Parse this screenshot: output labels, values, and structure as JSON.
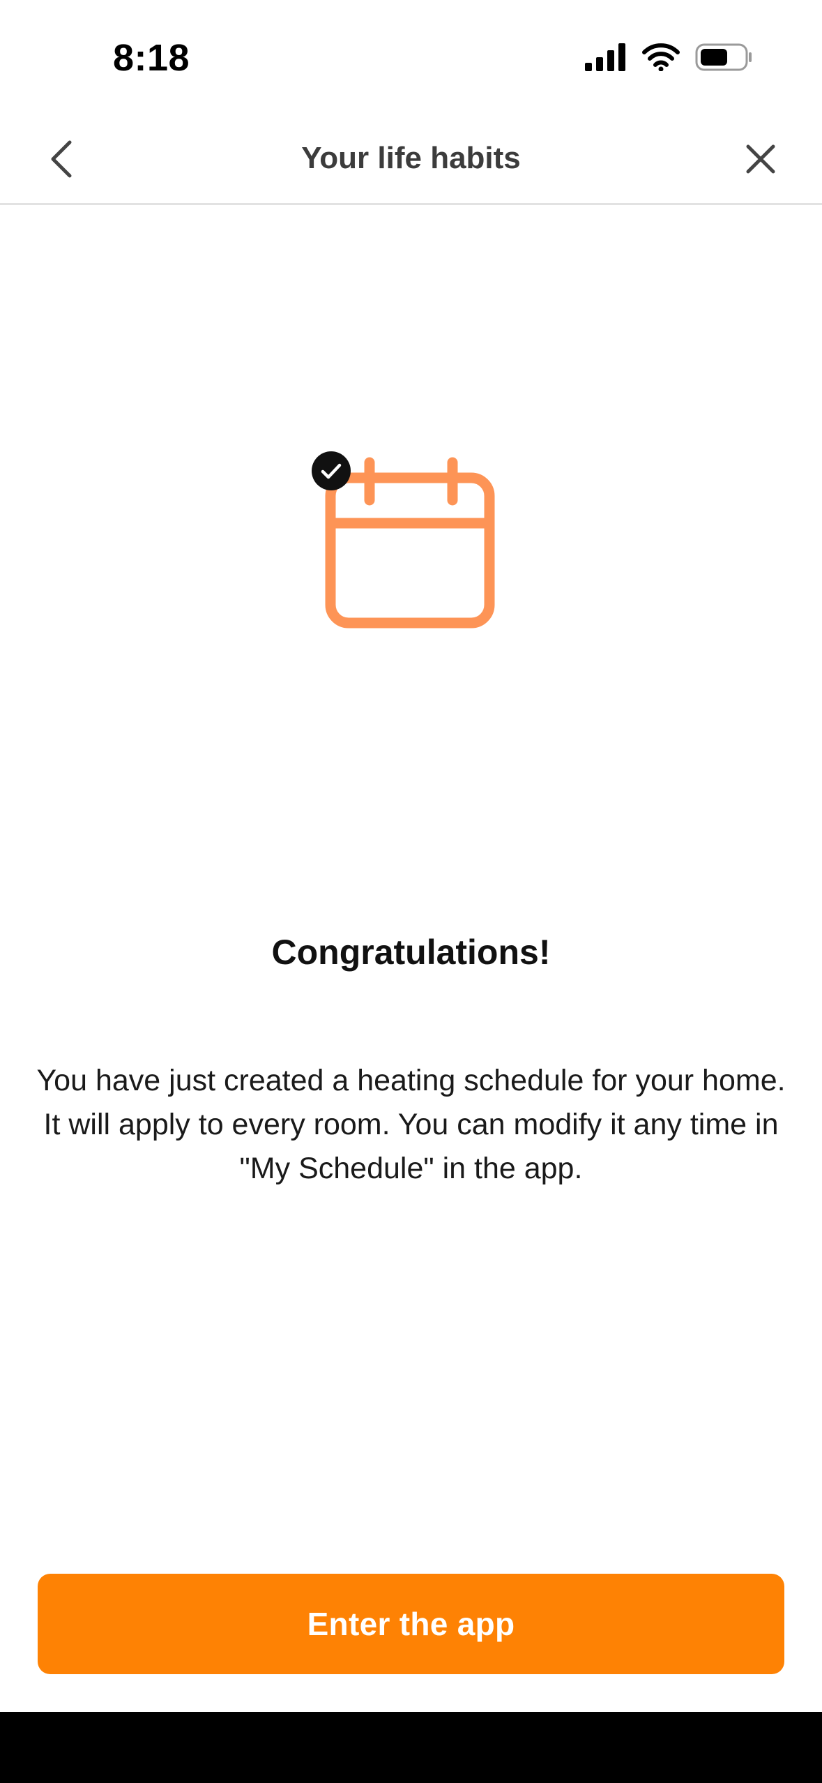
{
  "status_bar": {
    "time": "8:18",
    "icons": [
      "cellular-signal-icon",
      "wifi-icon",
      "battery-icon"
    ]
  },
  "nav": {
    "title": "Your life habits",
    "back_icon": "chevron-left-icon",
    "close_icon": "close-icon"
  },
  "illustration": {
    "icon": "calendar-icon",
    "badge_icon": "check-badge-icon",
    "calendar_color": "#fd9456",
    "badge_color": "#111111"
  },
  "content": {
    "headline": "Congratulations!",
    "body": "You have just created a heating schedule for your home. It will apply to every room. You can modify it any time in \"My Schedule\" in the app."
  },
  "cta": {
    "label": "Enter the app",
    "color": "#fe8204"
  }
}
